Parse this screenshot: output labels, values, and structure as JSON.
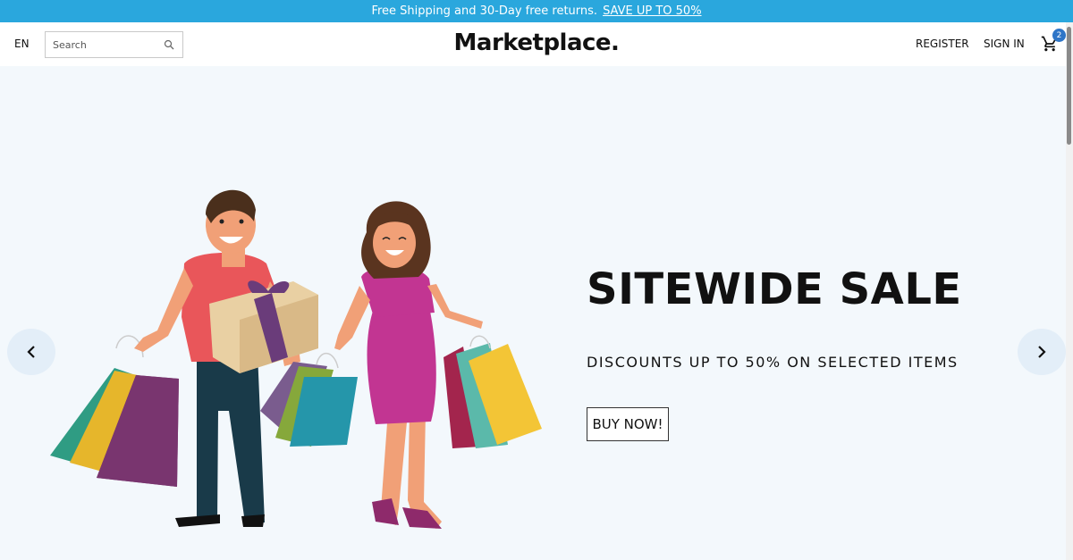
{
  "promo": {
    "text": "Free Shipping and 30-Day free returns.",
    "link": "SAVE UP TO 50%"
  },
  "header": {
    "language": "EN",
    "search_placeholder": "Search",
    "logo": "Marketplace.",
    "register": "REGISTER",
    "sign_in": "SIGN IN",
    "cart_count": "2"
  },
  "hero": {
    "headline": "SITEWIDE SALE",
    "subline": "DISCOUNTS UP TO 50% ON SELECTED ITEMS",
    "cta": "BUY NOW!"
  },
  "icons": {
    "search": "search-icon",
    "cart": "cart-icon",
    "prev": "chevron-left-icon",
    "next": "chevron-right-icon"
  },
  "colors": {
    "promo_bar": "#2aa7dd",
    "hero_background": "#f3f8fc",
    "cart_badge": "#2e75c7"
  }
}
